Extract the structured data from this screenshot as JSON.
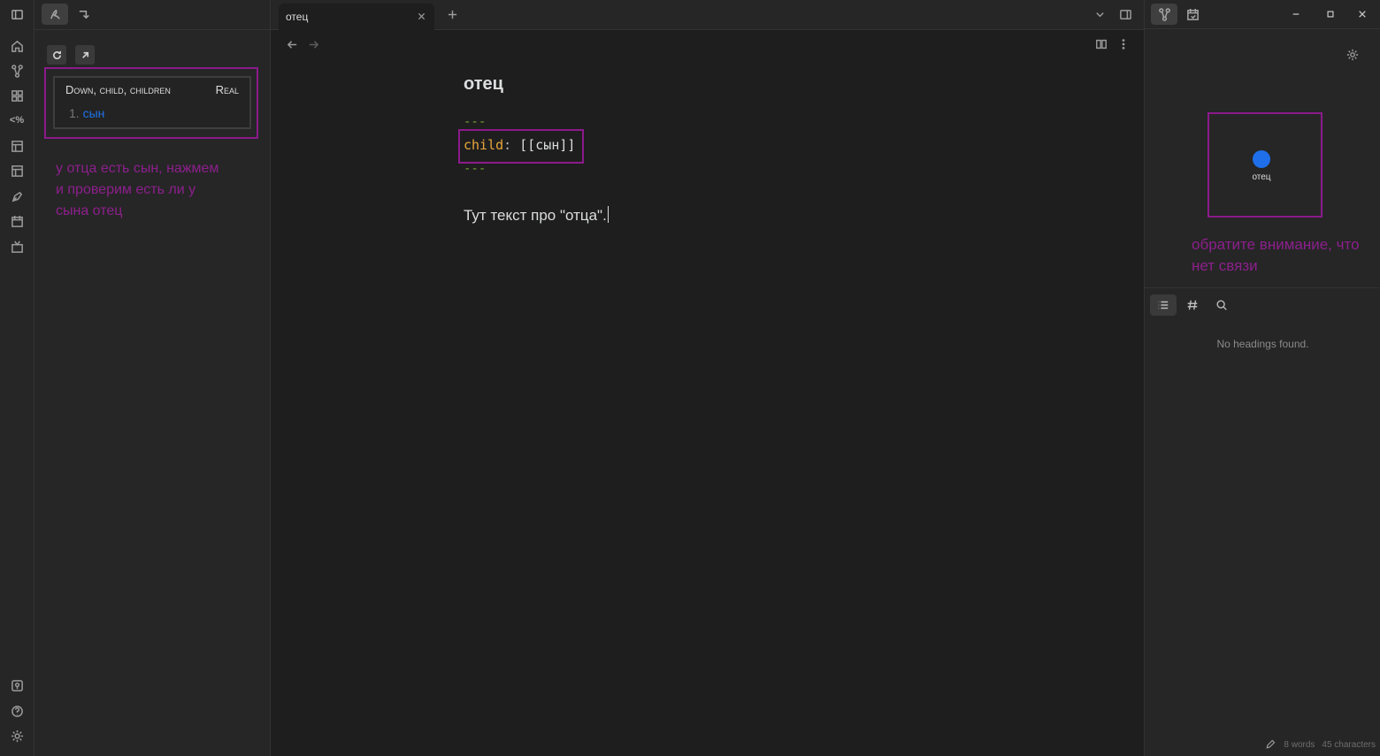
{
  "left_sidebar": {
    "hierarchy": {
      "header_label": "Down, child, children",
      "mode_label": "Real",
      "items": [
        {
          "number": "1.",
          "label": "сын"
        }
      ]
    },
    "annotation": "у отца есть сын, нажмем и проверим есть ли у сына отец"
  },
  "tabs": [
    {
      "label": "отец"
    }
  ],
  "editor": {
    "title": "отец",
    "frontmatter_open": "---",
    "frontmatter_key": "child",
    "frontmatter_sep": ":",
    "frontmatter_value": "[[сын]]",
    "frontmatter_close": "---",
    "body": "Тут текст про \"отца\"."
  },
  "right_sidebar": {
    "graph": {
      "node_label": "отец",
      "node_color": "#1f6feb"
    },
    "annotation": "обратите внимание, что нет связи",
    "outline_empty": "No headings found."
  },
  "status_bar": {
    "words": "8 words",
    "characters": "45 characters"
  },
  "colors": {
    "highlight": "#8b1a8b",
    "link": "#1e73e8",
    "fm_key": "#e8a63a",
    "fm_dash": "#6fa23a"
  },
  "icons": [
    "sidebar-toggle-icon",
    "breadcrumbs-icon",
    "redirect-icon",
    "home-icon",
    "graph-icon",
    "grid-icon",
    "template-icon",
    "layout-icon",
    "layout-alt-icon",
    "pen-icon",
    "calendar-icon",
    "tv-icon",
    "vault-icon",
    "help-icon",
    "settings-icon",
    "refresh-icon",
    "open-external-icon",
    "close-icon",
    "plus-icon",
    "back-icon",
    "forward-icon",
    "chevron-down-icon",
    "right-sidebar-toggle-icon",
    "reading-view-icon",
    "more-options-icon",
    "minimize-icon",
    "maximize-icon",
    "gear-icon",
    "list-icon",
    "hash-icon",
    "search-icon",
    "edit-icon"
  ]
}
